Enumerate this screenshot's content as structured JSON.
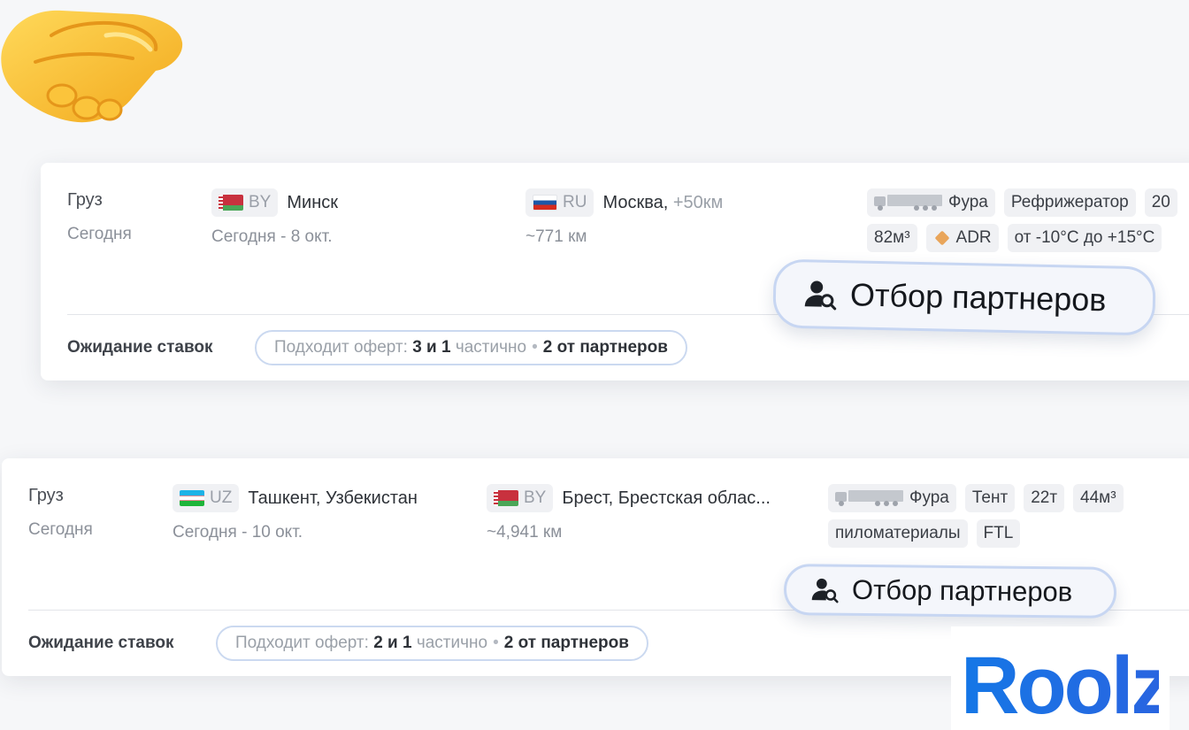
{
  "brand": {
    "logo_text": "Roolz",
    "accent": "#1e6fe8"
  },
  "cards": [
    {
      "type": "Груз",
      "date": "Сегодня",
      "origin": {
        "code": "BY",
        "flag": "flag-belarus",
        "city": "Минск",
        "date": "Сегодня - 8 окт."
      },
      "destination": {
        "code": "RU",
        "flag": "flag-russia",
        "city": "Москва,",
        "extra": "+50км",
        "distance": "~771 км"
      },
      "tags_row1": [
        "Фура",
        "Рефрижератор",
        "20"
      ],
      "tags_row2": [
        "82м³",
        "ADR",
        "от -10°C до +15°C"
      ],
      "status": "Ожидание ставок",
      "offers": {
        "prefix": "Подходит оферт:",
        "count": "3 и 1",
        "partial": "частично",
        "partners": "2 от партнеров"
      }
    },
    {
      "type": "Груз",
      "date": "Сегодня",
      "origin": {
        "code": "UZ",
        "flag": "flag-uzbekistan",
        "city": "Ташкент, Узбекистан",
        "date": "Сегодня - 10 окт."
      },
      "destination": {
        "code": "BY",
        "flag": "flag-belarus",
        "city": "Брест, Брестская облас...",
        "extra": "",
        "distance": "~4,941 км"
      },
      "tags_row1": [
        "Фура",
        "Тент",
        "22т",
        "44м³"
      ],
      "tags_row2": [
        "пиломатериалы",
        "FTL"
      ],
      "status": "Ожидание ставок",
      "offers": {
        "prefix": "Подходит оферт:",
        "count": "2 и 1",
        "partial": "частично",
        "partners": "2 от партнеров"
      }
    }
  ],
  "partner_button_label": "Отбор партнеров",
  "icons": [
    "handshake-emoji",
    "truck-icon",
    "adr-diamond-icon",
    "user-search-icon"
  ]
}
